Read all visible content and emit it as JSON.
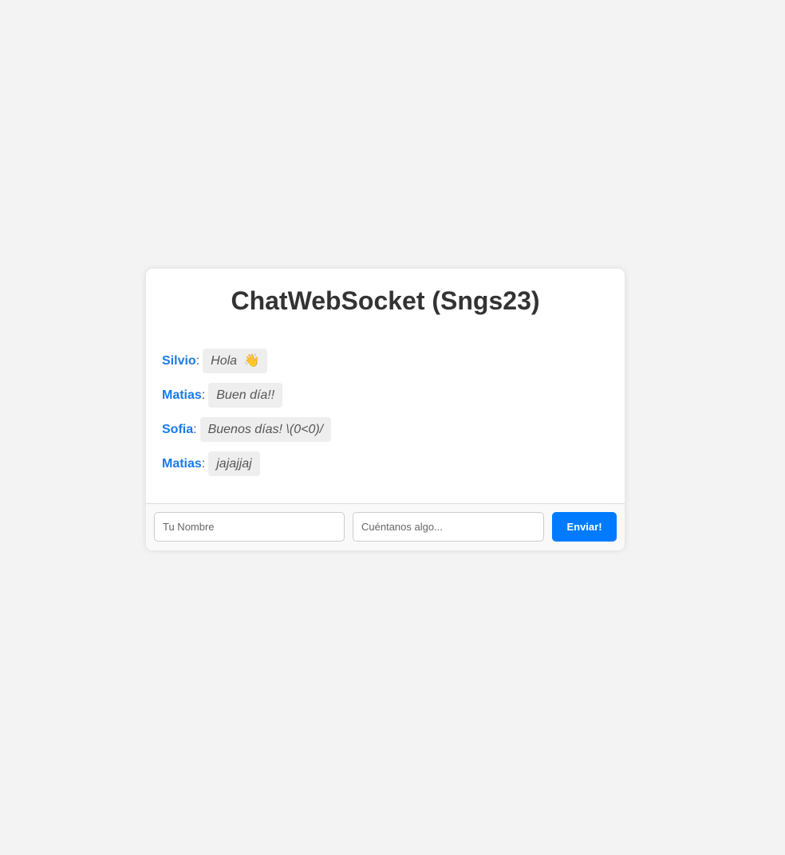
{
  "chat": {
    "title": "ChatWebSocket (Sngs23)",
    "messages": [
      {
        "user": "Silvio",
        "sep": ":",
        "text": "Hola",
        "emoji": "👋"
      },
      {
        "user": "Matias",
        "sep": ":",
        "text": "Buen día!!"
      },
      {
        "user": "Sofia",
        "sep": ":",
        "text": "Buenos días! \\(0<0)/"
      },
      {
        "user": "Matias",
        "sep": ":",
        "text": "jajajjaj"
      }
    ]
  },
  "form": {
    "name_placeholder": "Tu Nombre",
    "name_value": "",
    "message_placeholder": "Cuéntanos algo...",
    "message_value": "",
    "send_label": "Enviar!"
  },
  "colors": {
    "accent": "#007bff",
    "username": "#1a7be8",
    "background": "#f3f3f3"
  }
}
